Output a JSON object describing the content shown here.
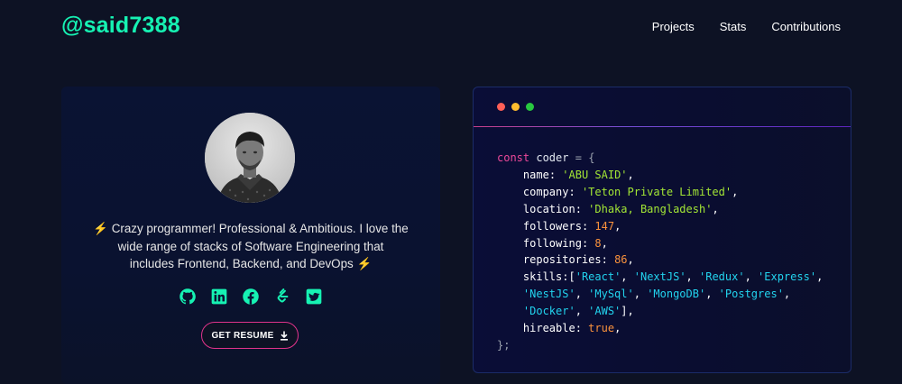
{
  "header": {
    "logo": "@said7388",
    "nav": [
      "Projects",
      "Stats",
      "Contributions"
    ]
  },
  "profile": {
    "bio_line1": "Crazy programmer! Professional & Ambitious. I love the",
    "bio_line2": "wide range of stacks of Software Engineering that",
    "bio_line3": "includes Frontend, Backend, and DevOps",
    "socials": [
      "github-icon",
      "linkedin-icon",
      "facebook-icon",
      "leetcode-icon",
      "twitter-icon"
    ],
    "resume_label": "GET RESUME"
  },
  "code": {
    "kw_const": "const",
    "var_name": "coder",
    "fields": {
      "name_key": "name",
      "name_val": "'ABU SAID'",
      "company_key": "company",
      "company_val": "'Teton Private Limited'",
      "location_key": "location",
      "location_val": "'Dhaka, Bangladesh'",
      "followers_key": "followers",
      "followers_val": "147",
      "following_key": "following",
      "following_val": "8",
      "repositories_key": "repositories",
      "repositories_val": "86",
      "skills_key": "skills",
      "skills": [
        "'React'",
        "'NextJS'",
        "'Redux'",
        "'Express'",
        "'NestJS'",
        "'MySql'",
        "'MongoDB'",
        "'Postgres'",
        "'Docker'",
        "'AWS'"
      ],
      "hireable_key": "hireable",
      "hireable_val": "true"
    }
  },
  "colors": {
    "accent": "#16f2b3",
    "background": "#0d1224",
    "dot_red": "#ff5f57",
    "dot_yellow": "#ffbd2e",
    "dot_green": "#28c840",
    "button_border": "#e0338b",
    "bolt": "#f5a623"
  }
}
